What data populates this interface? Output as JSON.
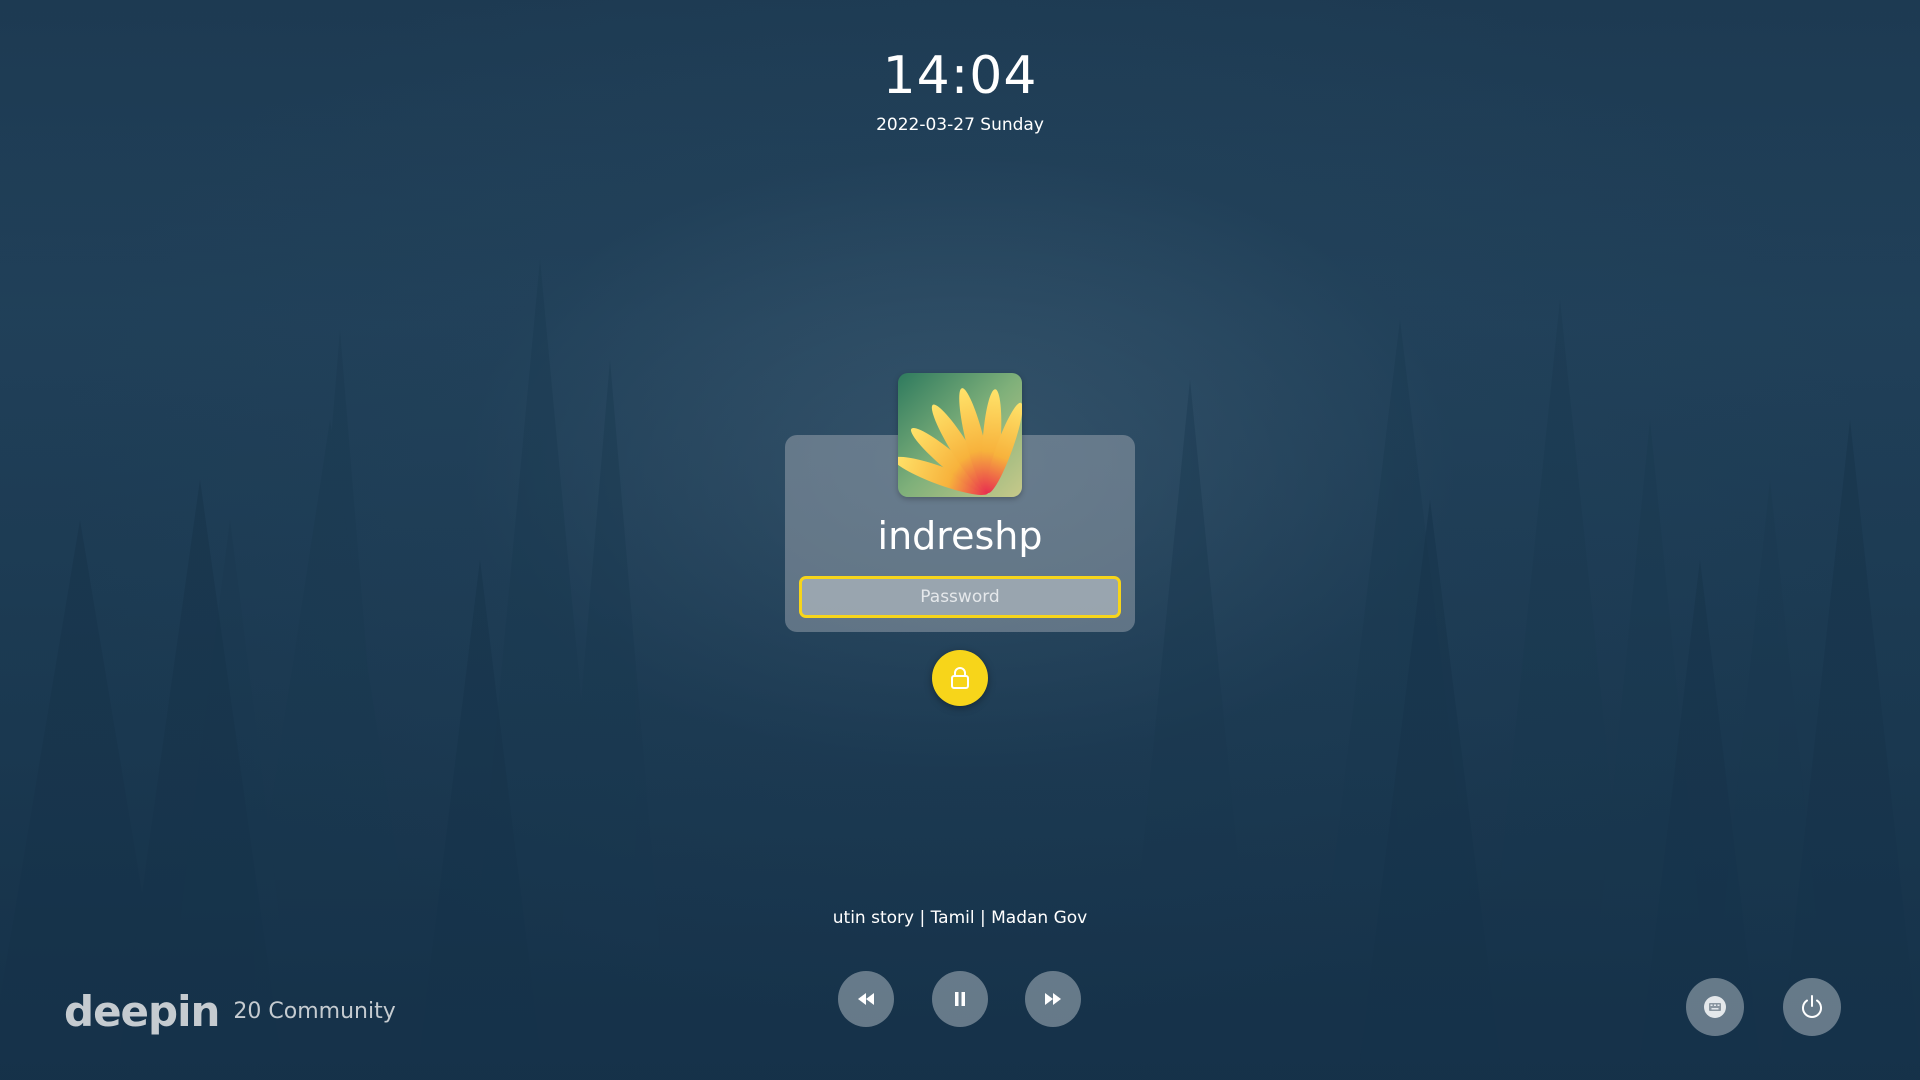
{
  "clock": {
    "time": "14:04",
    "date": "2022-03-27 Sunday"
  },
  "user": {
    "name": "indreshp",
    "avatar_icon": "flower-avatar"
  },
  "password": {
    "placeholder": "Password",
    "value": ""
  },
  "unlock_button": {
    "icon": "lock-icon",
    "color": "#f7d51a"
  },
  "media": {
    "track_title": "utin story | Tamil | Madan Gov",
    "controls": [
      {
        "name": "previous-track",
        "icon": "rewind-icon"
      },
      {
        "name": "pause",
        "icon": "pause-icon"
      },
      {
        "name": "next-track",
        "icon": "fast-forward-icon"
      }
    ]
  },
  "branding": {
    "logo": "deepin",
    "edition": "20 Community"
  },
  "system_buttons": [
    {
      "name": "keyboard-layout",
      "icon": "keyboard-icon"
    },
    {
      "name": "power",
      "icon": "power-icon"
    }
  ],
  "colors": {
    "accent": "#f7d51a",
    "background": "#1c3a52"
  }
}
